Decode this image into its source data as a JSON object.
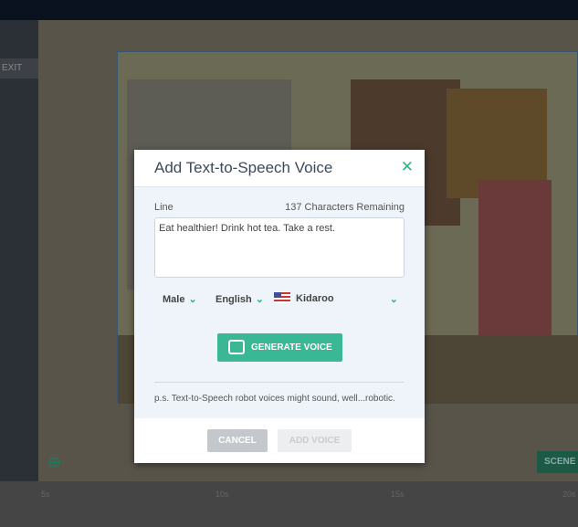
{
  "background": {
    "exit_label": "EXIT",
    "scene_label": "SCENE",
    "timeline_ticks": [
      "5s",
      "10s",
      "15s",
      "20s"
    ]
  },
  "dialog": {
    "title": "Add Text-to-Speech Voice",
    "line_label": "Line",
    "chars_remaining": "137 Characters Remaining",
    "line_value": "Eat healthier! Drink hot tea. Take a rest.",
    "gender": "Male",
    "language": "English",
    "voice": "Kidaroo",
    "generate_label": "GENERATE VOICE",
    "note": "p.s. Text-to-Speech robot voices might sound, well...robotic.",
    "cancel_label": "CANCEL",
    "add_label": "ADD VOICE",
    "accent": "#3ab795"
  }
}
